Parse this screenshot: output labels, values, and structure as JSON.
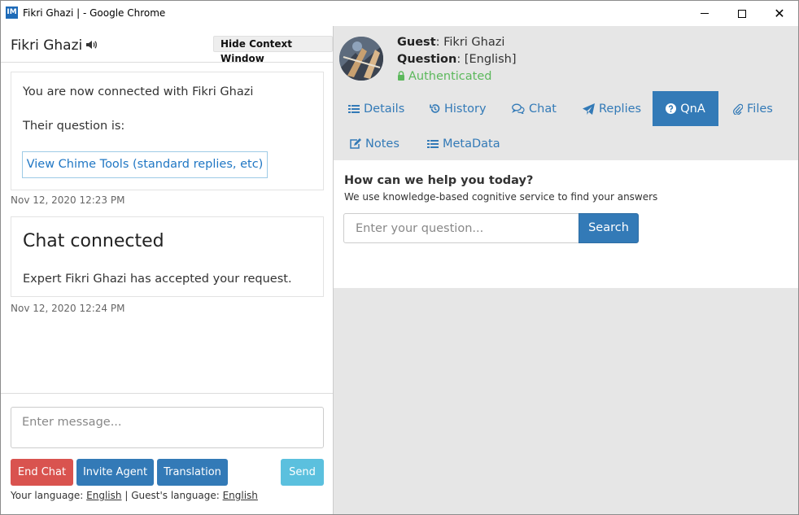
{
  "window": {
    "title": "Fikri Ghazi | - Google Chrome",
    "icon_text": "IM"
  },
  "chat": {
    "title": "Fikri Ghazi",
    "hide_context_label": "Hide Context Window",
    "messages": [
      {
        "line1": "You are now connected with Fikri Ghazi",
        "line2": "Their question is:",
        "tools_link": "View Chime Tools (standard replies, etc)",
        "timestamp": "Nov 12, 2020 12:23 PM"
      },
      {
        "heading": "Chat connected",
        "body": "Expert Fikri Ghazi has accepted your request.",
        "timestamp": "Nov 12, 2020 12:24 PM"
      }
    ],
    "composer": {
      "placeholder": "Enter message...",
      "end_chat": "End Chat",
      "invite_agent": "Invite Agent",
      "translation": "Translation",
      "send": "Send",
      "your_language_label": "Your language:",
      "your_language": "English",
      "separator": "|",
      "guest_language_label": "Guest's language:",
      "guest_language": "English"
    }
  },
  "guest": {
    "guest_label": "Guest",
    "guest_name": ": Fikri Ghazi",
    "question_label": "Question",
    "question_value": ": [English]",
    "auth_status": "Authenticated"
  },
  "tabs": {
    "details": "Details",
    "history": "History",
    "chat": "Chat",
    "replies": "Replies",
    "qna": "QnA",
    "files": "Files",
    "notes": "Notes",
    "metadata": "MetaData"
  },
  "qna": {
    "title": "How can we help you today?",
    "subtitle": "We use knowledge-based cognitive service to find your answers",
    "placeholder": "Enter your question...",
    "search": "Search"
  },
  "colors": {
    "primary": "#337ab7",
    "danger": "#d9534f",
    "info": "#5bc0de",
    "success": "#5cb85c",
    "panel_bg": "#e6e6e6"
  },
  "icons": [
    "speaker-icon",
    "lock-icon",
    "list-icon",
    "history-icon",
    "comments-icon",
    "paper-plane-icon",
    "question-circle-icon",
    "paperclip-icon",
    "edit-icon",
    "minimize-icon",
    "maximize-icon",
    "close-icon"
  ]
}
